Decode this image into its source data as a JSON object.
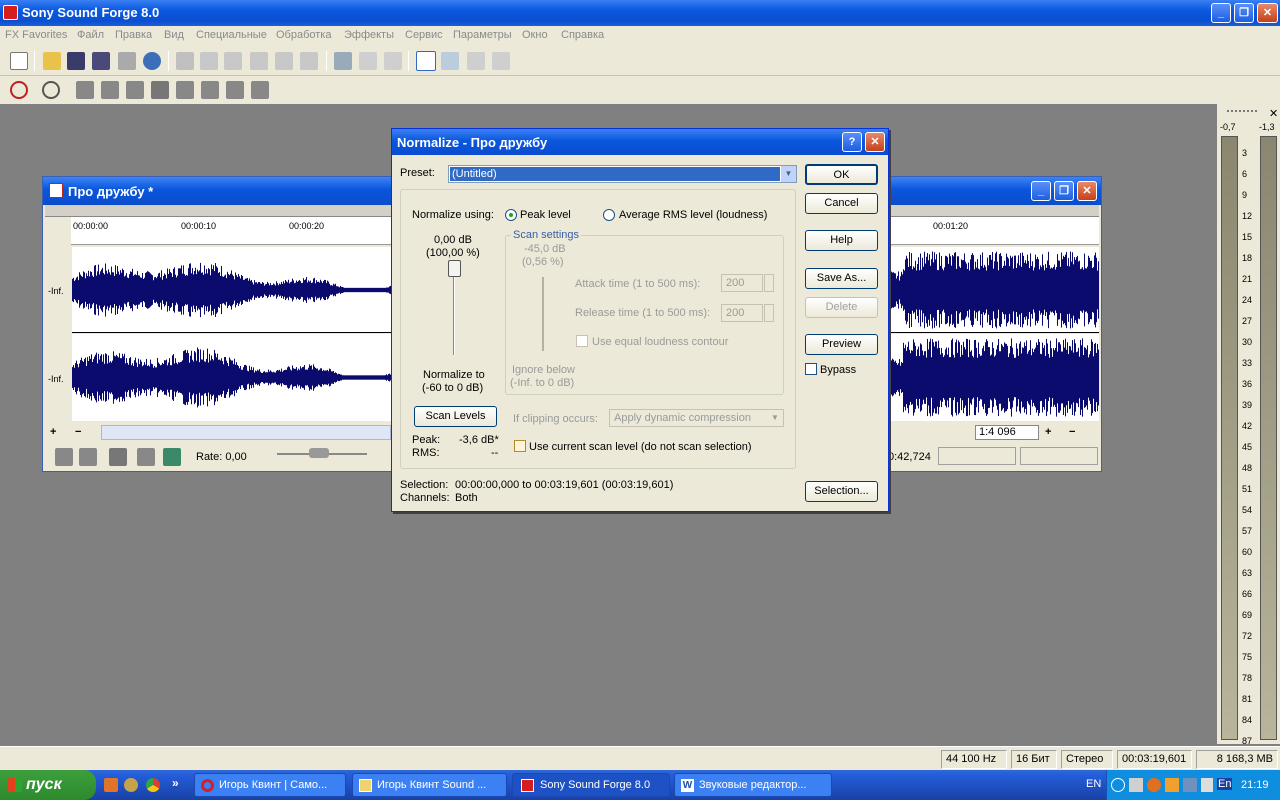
{
  "app": {
    "title": "Sony Sound Forge 8.0",
    "minimize": "_",
    "restore": "❐",
    "close": "✕"
  },
  "menu": [
    "FX Favorites",
    "Файл",
    "Правка",
    "Вид",
    "Специальные",
    "Обработка",
    "Эффекты",
    "Сервис",
    "Параметры",
    "Окно",
    "Справка"
  ],
  "doc": {
    "title": "Про дружбу *",
    "ruler": [
      "00:00:00",
      "00:00:10",
      "00:00:20",
      "00:01:20"
    ],
    "db_top": "-Inf.",
    "db_bot": "-Inf.",
    "plus": "+",
    "minus": "−",
    "zoom": "1:4 096",
    "rate": "Rate: 0,00",
    "time": "0:42,724"
  },
  "dialog": {
    "title": "Normalize - Про дружбу",
    "help": "?",
    "close": "✕",
    "preset_label": "Preset:",
    "preset_value": "(Untitled)",
    "normalize_using": "Normalize using:",
    "peak": "Peak level",
    "rms": "Average RMS level (loudness)",
    "level_db": "0,00 dB",
    "level_pct": "(100,00 %)",
    "normalize_to": "Normalize to",
    "normalize_range": "(-60 to 0 dB)",
    "scan_settings": "Scan settings",
    "scan_db": "-45,0 dB",
    "scan_pct": "(0,56 %)",
    "attack_label": "Attack time (1 to 500 ms):",
    "attack_value": "200",
    "release_label": "Release time (1 to 500 ms):",
    "release_value": "200",
    "equal_loudness": "Use equal loudness contour",
    "ignore_below": "Ignore below",
    "ignore_range": "(-Inf. to 0 dB)",
    "scan_levels": "Scan Levels",
    "clipping_label": "If clipping occurs:",
    "clipping_value": "Apply dynamic compression",
    "peak_label": "Peak:",
    "peak_value": "-3,6 dB*",
    "rms_label": "RMS:",
    "rms_value": "--",
    "use_current": "Use current scan level (do not scan selection)",
    "selection_label": "Selection:",
    "selection_value": "00:00:00,000 to 00:03:19,601 (00:03:19,601)",
    "channels_label": "Channels:",
    "channels_value": "Both",
    "buttons": {
      "ok": "OK",
      "cancel": "Cancel",
      "help": "Help",
      "save_as": "Save As...",
      "delete": "Delete",
      "preview": "Preview",
      "bypass": "Bypass",
      "selection": "Selection..."
    }
  },
  "vu": {
    "left": "-0,7",
    "right": "-1,3",
    "scale": [
      "3",
      "6",
      "9",
      "12",
      "15",
      "18",
      "21",
      "24",
      "27",
      "30",
      "33",
      "36",
      "39",
      "42",
      "45",
      "48",
      "51",
      "54",
      "57",
      "60",
      "63",
      "66",
      "69",
      "72",
      "75",
      "78",
      "81",
      "84",
      "87"
    ]
  },
  "status": [
    "44 100 Hz",
    "16 Бит",
    "Стерео",
    "00:03:19,601",
    "8 168,3 MB"
  ],
  "taskbar": {
    "start": "пуск",
    "tasks": [
      "Игорь Квинт | Само...",
      "Игорь Квинт Sound ...",
      "Sony Sound Forge 8.0",
      "Звуковые редактор..."
    ],
    "lang": "EN",
    "lang2": "En",
    "clock": "21:19"
  },
  "colors": {
    "title_blue": "#0a58e0",
    "wave": "#0b0b6e",
    "face": "#ece9d8"
  }
}
